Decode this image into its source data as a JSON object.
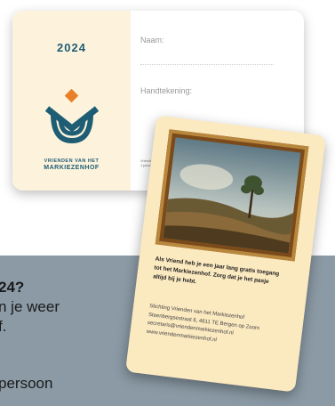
{
  "card_front": {
    "year": "2024",
    "logo_line1": "VRIENDEN VAN HET",
    "logo_line2": "MARKIEZENHOF",
    "name_label": "Naam:",
    "signature_label": "Handtekening:",
    "footer_line1": "Vrienden...",
    "footer_line2": "1 januari..."
  },
  "card_back": {
    "message_lines": [
      "Als Vriend heb je een jaar lang gratis toegang",
      "tot het Markiezenhof. Zorg dat je het pasje",
      "altijd bij je hebt."
    ],
    "address_lines": [
      "Stichting Vrienden van het Markiezenhof",
      "Steenbergsestraat 6, 4611 TE  Bergen op Zoom",
      "secretaris@vriendenmarkiezenhof.nl",
      "www.vriendenmarkiezenhof.nl"
    ]
  },
  "bottom_text": {
    "line1": "24?",
    "line2": "n je weer",
    "line3": "f.",
    "line4": "persoon"
  },
  "colors": {
    "brand_teal": "#1e5d74",
    "accent_orange": "#e8802a",
    "card_cream": "#fdf3dd",
    "panel_gray": "#8b9aa5"
  }
}
